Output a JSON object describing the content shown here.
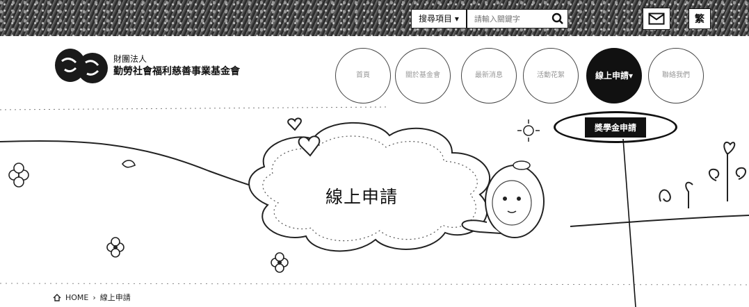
{
  "topbar": {
    "search_category": "搜尋項目 ▾",
    "search_placeholder": "請輸入關鍵字",
    "lang_label": "繁"
  },
  "logo": {
    "line1": "財團法人",
    "line2": "勤勞社會福利慈善事業基金會"
  },
  "nav": {
    "items": [
      {
        "label": "首頁"
      },
      {
        "label": "關於基金會"
      },
      {
        "label": "最新消息"
      },
      {
        "label": "活動花絮"
      },
      {
        "label": "線上申請▾"
      },
      {
        "label": "聯絡我們"
      }
    ],
    "dropdown_item": "獎學金申請"
  },
  "banner": {
    "title": "線上申請"
  },
  "breadcrumb": {
    "home": "HOME",
    "separator": "›",
    "current": "線上申請"
  },
  "colors": {
    "active_nav": "#111111",
    "topbar": "#3a3a3a"
  }
}
